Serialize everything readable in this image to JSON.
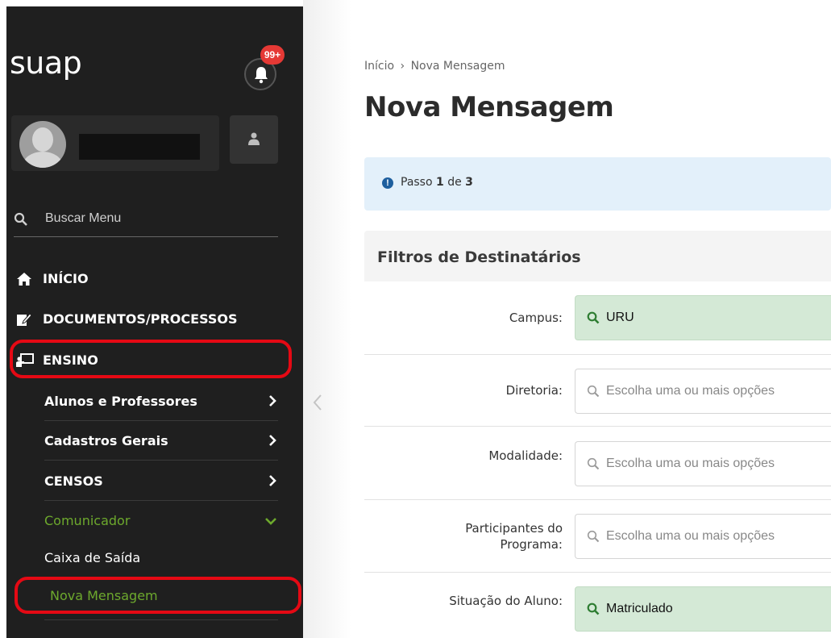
{
  "app": {
    "logo": "suap",
    "notifications_badge": "99+"
  },
  "sidebar": {
    "search_placeholder": "Buscar Menu",
    "menu": [
      {
        "label": "INÍCIO",
        "icon": "home-icon"
      },
      {
        "label": "DOCUMENTOS/PROCESSOS",
        "icon": "document-edit-icon"
      },
      {
        "label": "ENSINO",
        "icon": "teaching-icon"
      }
    ],
    "ensino_items": [
      {
        "label": "Alunos e Professores",
        "icon": "chevron-right-icon"
      },
      {
        "label": "Cadastros Gerais",
        "icon": "chevron-right-icon"
      },
      {
        "label": "CENSOS",
        "icon": "chevron-right-icon"
      },
      {
        "label": "Comunicador",
        "icon": "chevron-down-icon"
      }
    ],
    "comunicador_items": [
      {
        "label": "Caixa de Saída"
      },
      {
        "label": "Nova Mensagem"
      }
    ],
    "highlight_color": "#e50914",
    "active_color": "#6da92d"
  },
  "main": {
    "breadcrumb": {
      "home": "Início",
      "separator": "›",
      "current": "Nova Mensagem"
    },
    "title": "Nova Mensagem",
    "step": {
      "prefix": "Passo",
      "current": "1",
      "middle": "de",
      "total": "3"
    },
    "filters": {
      "title": "Filtros de Destinatários",
      "fields": [
        {
          "label": "Campus:",
          "value": "URU",
          "placeholder": ""
        },
        {
          "label": "Diretoria:",
          "value": "",
          "placeholder": "Escolha uma ou mais opções"
        },
        {
          "label": "Modalidade:",
          "value": "",
          "placeholder": "Escolha uma ou mais opções"
        },
        {
          "label_line1": "Participantes do",
          "label_line2": "Programa:",
          "value": "",
          "placeholder": "Escolha uma ou mais opções"
        },
        {
          "label": "Situação do Aluno:",
          "value": "Matriculado",
          "placeholder": ""
        }
      ]
    }
  }
}
